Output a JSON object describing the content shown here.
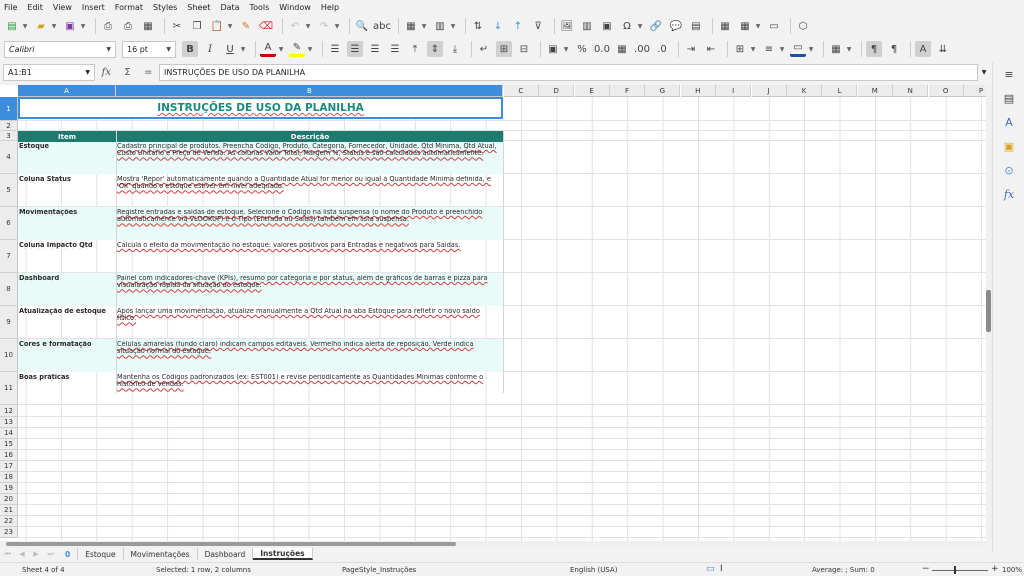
{
  "menu": [
    "File",
    "Edit",
    "View",
    "Insert",
    "Format",
    "Styles",
    "Sheet",
    "Data",
    "Tools",
    "Window",
    "Help"
  ],
  "toolbar": {
    "font_name": "Calibri",
    "font_size": "16 pt"
  },
  "formula_bar": {
    "name_box": "A1:B1",
    "content": "INSTRUÇÕES DE USO DA PLANILHA"
  },
  "columns": [
    "A",
    "B",
    "C",
    "D",
    "E",
    "F",
    "G",
    "H",
    "I",
    "J",
    "K",
    "L",
    "M",
    "N",
    "O",
    "P"
  ],
  "rows": [
    "1",
    "2",
    "3",
    "4",
    "5",
    "6",
    "7",
    "8",
    "9",
    "10",
    "11",
    "12",
    "13",
    "14",
    "15",
    "16",
    "17",
    "18",
    "19",
    "20",
    "21",
    "22",
    "23"
  ],
  "sheet": {
    "title": "INSTRUÇÕES DE USO DA PLANILHA",
    "header": {
      "item": "Item",
      "descricao": "Descrição"
    },
    "entries": [
      {
        "item": "Estoque",
        "desc": "Cadastro principal de produtos. Preencha Código, Produto, Categoria, Fornecedor, Unidade, Qtd Mínima, Qtd Atual, Custo Unitário e Preço de Venda. As colunas Valor Total, Margem %, Status e são calculadas automaticamente."
      },
      {
        "item": "Coluna Status",
        "desc": "Mostra 'Repor' automaticamente quando a Quantidade Atual for menor ou igual à Quantidade Mínima definida, e 'OK' quando o estoque estiver em nível adequado."
      },
      {
        "item": "Movimentações",
        "desc": "Registre entradas e saídas de estoque. Selecione o Código na lista suspensa (o nome do Produto é preenchido automaticamente via VLOOKUP) e o Tipo (Entrada ou Saída) também em lista suspensa."
      },
      {
        "item": "Coluna Impacto Qtd",
        "desc": "Calcula o efeito da movimentação no estoque: valores positivos para Entradas e negativos para Saídas."
      },
      {
        "item": "Dashboard",
        "desc": "Painel com indicadores-chave (KPIs), resumo por categoria e por status, além de gráficos de barras e pizza para visualização rápida da situação do estoque."
      },
      {
        "item": "Atualização de estoque",
        "desc": "Após lançar uma movimentação, atualize manualmente a Qtd Atual na aba Estoque para refletir o novo saldo físico."
      },
      {
        "item": "Cores e formatação",
        "desc": "Células amarelas (fundo claro) indicam campos editáveis. Vermelho indica alerta de reposição. Verde indica situação normal do estoque."
      },
      {
        "item": "Boas práticas",
        "desc": "Mantenha os Códigos padronizados (ex: EST001) e revise periodicamente as Quantidades Mínimas conforme o histórico de vendas."
      }
    ]
  },
  "tabs": {
    "add": "0",
    "list": [
      "Estoque",
      "Movimentações",
      "Dashboard",
      "Instruções"
    ],
    "active": "Instruções"
  },
  "status": {
    "sheet": "Sheet 4 of 4",
    "selection": "Selected: 1 row, 2 columns",
    "page_style": "PageStyle_Instruções",
    "language": "English (USA)",
    "summary": "Average: ; Sum: 0",
    "zoom": "100%"
  }
}
